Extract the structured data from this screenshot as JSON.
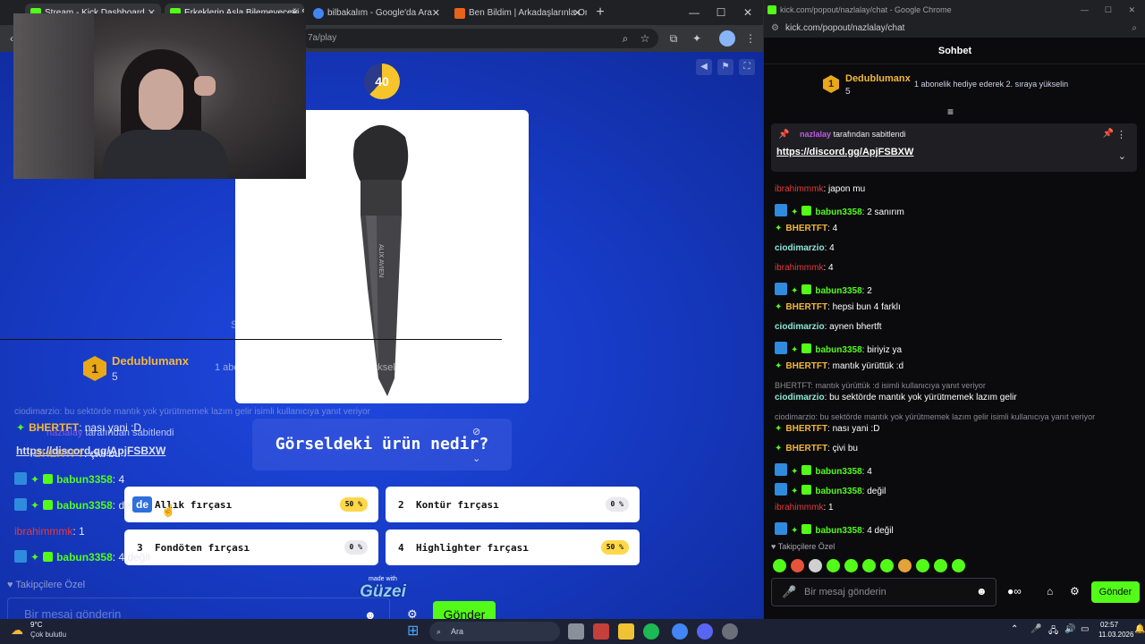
{
  "left_browser": {
    "tabs": [
      {
        "label": "Stream - Kick Dashboard",
        "favicon_color": "#53fc18"
      },
      {
        "label": "Erkeklerin Asla Bilemeyeceği So",
        "favicon_color": "#53fc18"
      },
      {
        "label": "bilbakalım - Google'da Ara",
        "favicon_color": "#4285f4"
      },
      {
        "label": "Ben Bildim | Arkadaşlarınla Onli",
        "favicon_color": "#e8631a"
      }
    ],
    "url": "7a/play"
  },
  "game": {
    "timer": "40",
    "question": "Görseldeki ürün nedir?",
    "answers": [
      {
        "num": "1",
        "label": "Allık fırçası",
        "pct": "50 %"
      },
      {
        "num": "2",
        "label": "Kontür fırçası",
        "pct": "0 %"
      },
      {
        "num": "3",
        "label": "Fondöten fırçası",
        "pct": "0 %"
      },
      {
        "num": "4",
        "label": "Highlighter fırçası",
        "pct": "50 %"
      }
    ],
    "made_with": "made with",
    "brand": "Güzei",
    "brush_text": "ALIX AVIEN"
  },
  "overlay": {
    "chat_title": "Sohbet",
    "leader_name": "Dedublumanx",
    "leader_count": "5",
    "leader_msg": "1 abonelik hediye ederek 2. sıraya yükselin",
    "reply_line": "ciodimarzio: bu sektörde mantık yok yürütmemek lazım gelir isimli kullanıcıya yanıt veriyor",
    "line1_user": "BHERTFT",
    "line1_msg": "nası yani :D",
    "pinned_by": "nazlalay",
    "pinned_suffix": "tarafından sabitlendi",
    "pinned_link": "https://discord.gg/ApjFSBXW",
    "line2_user": "BHERTFT",
    "line2_msg": "çivi bu",
    "line3_user": "babun3358",
    "line3_msg": "4",
    "line4_user": "babun3358",
    "line4_msg": "değil",
    "line5_user": "ibrahimmmk",
    "line5_msg": "1",
    "line6_user": "babun3358",
    "line6_msg": "4 değil",
    "followers_only": "Takipçilere Özel",
    "input_placeholder": "Bir mesaj gönderin",
    "send": "Gönder",
    "de_tag": "de"
  },
  "right_chat": {
    "window_title": "kick.com/popout/nazlalay/chat - Google Chrome",
    "url": "kick.com/popout/nazlalay/chat",
    "header": "Sohbet",
    "leader_name": "Dedublumanx",
    "leader_count": "5",
    "leader_msg": "1 abonelik hediye ederek 2. sıraya yükselin",
    "pinned_by": "nazlalay",
    "pinned_suffix": "tarafından sabitlendi",
    "pinned_link": "https://discord.gg/ApjFSBXW",
    "messages": [
      {
        "user": "ibrahimmmk",
        "text": "japon mu"
      },
      {
        "user": "babun3358",
        "text": "2 sanırım"
      },
      {
        "user": "BHERTFT",
        "text": "4"
      },
      {
        "user": "ciodimarzio",
        "text": "4"
      },
      {
        "user": "ibrahimmmk",
        "text": "4"
      },
      {
        "user": "babun3358",
        "text": "2"
      },
      {
        "user": "BHERTFT",
        "text": "hepsi bun 4 farklı"
      },
      {
        "user": "ciodimarzio",
        "text": "aynen bhertft"
      },
      {
        "user": "babun3358",
        "text": "biriyiz ya"
      },
      {
        "user": "BHERTFT",
        "text": "mantık yürüttük :d"
      },
      {
        "reply": "BHERTFT: mantık yürüttük :d isimli kullanıcıya yanıt veriyor"
      },
      {
        "user": "ciodimarzio",
        "text": "bu sektörde mantık yok yürütmemek lazım gelir"
      },
      {
        "reply": "ciodimarzio: bu sektörde mantık yok yürütmemek lazım gelir isimli kullanıcıya yanıt veriyor"
      },
      {
        "user": "BHERTFT",
        "text": "nası yani :D"
      },
      {
        "user": "BHERTFT",
        "text": "çivi bu"
      },
      {
        "user": "babun3358",
        "text": "4"
      },
      {
        "user": "babun3358",
        "text": "değil"
      },
      {
        "user": "ibrahimmmk",
        "text": "1"
      },
      {
        "user": "babun3358",
        "text": "4 değil"
      }
    ],
    "followers_only": "Takipçilere Özel",
    "input_placeholder": "Bir mesaj gönderin",
    "send": "Gönder"
  },
  "taskbar": {
    "weather_temp": "9°C",
    "weather_desc": "Çok bulutlu",
    "search": "Ara",
    "time": "02:57",
    "date": "11.03.2026"
  }
}
